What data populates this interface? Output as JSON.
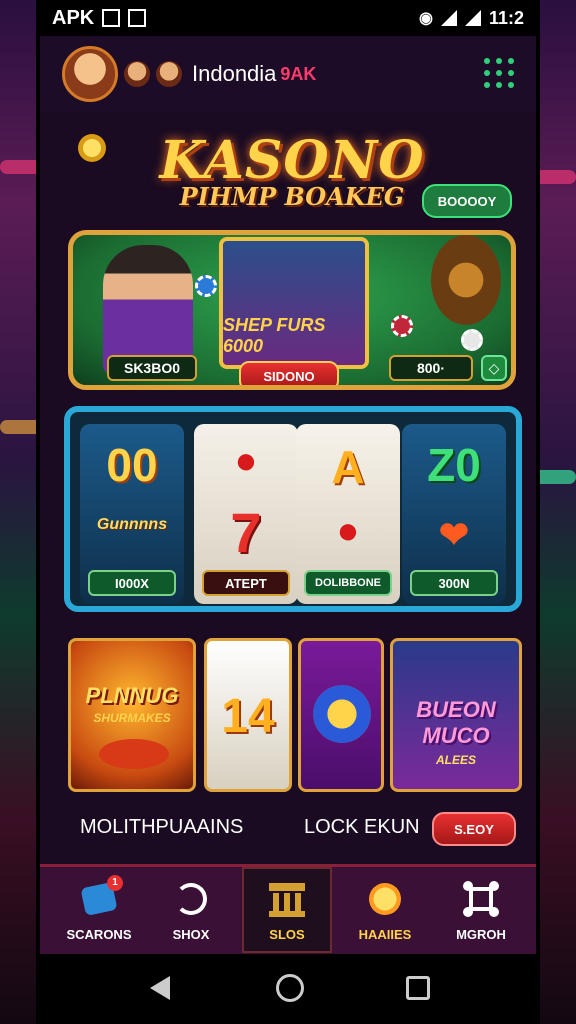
{
  "statusbar": {
    "carrier": "APK",
    "time": "11:2"
  },
  "header": {
    "title": "Indondia",
    "badge": "9AK"
  },
  "hero": {
    "title": "KASONO",
    "subtitle": "PIHMP BOAKEG",
    "green_button": "BOOOOY",
    "center_card_text": "SHEP FURS 6000",
    "left_label": "SK3BO0",
    "center_button": "SIDONO",
    "right_label": "800·"
  },
  "slots": {
    "reels": [
      {
        "symbol": "00",
        "label": "I000X"
      },
      {
        "symbol": "7",
        "label": "ATEPT"
      },
      {
        "symbol": "A",
        "label": "DOLIBBONE"
      },
      {
        "symbol": "Z0",
        "label": "300N"
      }
    ],
    "reel_sub": "Gunnnns"
  },
  "tiles": [
    {
      "title": "PLNNUG",
      "subtitle": "SHURMAKES"
    },
    {
      "title": "14"
    },
    {
      "title": ""
    },
    {
      "title": "BUEON MUCO",
      "subtitle": "ALEES"
    }
  ],
  "row_labels": {
    "left": "MOLITHPUAAINS",
    "center": "LOCK EKUN",
    "button": "S.EOY"
  },
  "nav": {
    "items": [
      {
        "label": "SCARONS",
        "badge": "1"
      },
      {
        "label": "SHOX"
      },
      {
        "label": "SLOS"
      },
      {
        "label": "HAAIIES"
      },
      {
        "label": "MGROH"
      }
    ]
  },
  "colors": {
    "accent_gold": "#e0a23a",
    "brand_red": "#e83030",
    "green": "#2fd07a",
    "slot_frame": "#2aa8d8"
  }
}
